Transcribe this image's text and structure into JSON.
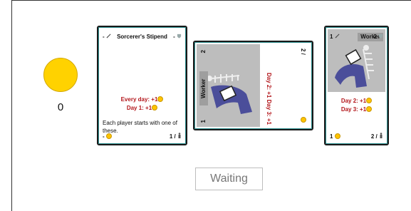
{
  "player": {
    "coins": "0"
  },
  "cards": [
    {
      "title": "Sorcerer's Stipend",
      "corner_tl": "-",
      "corner_tr": "-",
      "effect_line1": "Every day: +1",
      "effect_line2": "Day 1: +1",
      "description": "Each player starts with one of these.",
      "corner_bl": "-",
      "corner_br": "1 /"
    },
    {
      "title": "Worker",
      "corner_tl": "2",
      "corner_bl": "1",
      "corner_tr": "2 /",
      "effect_line1": "Day 2: +1",
      "effect_line2": "Day 3: +1",
      "rotated": true
    },
    {
      "title": "Worker",
      "corner_tl": "1",
      "corner_tr": "2",
      "effect_line1": "Day 2: +1",
      "effect_line2": "Day 3: +1",
      "corner_bl": "1",
      "corner_br": "2 /"
    }
  ],
  "status_text": "Waiting",
  "colors": {
    "coin": "#ffd200",
    "effect_text": "#b3161b",
    "card_border": "#1a1a1a",
    "art_bg": "#bdbdbd",
    "figure": "#4b4e9a"
  },
  "icons": [
    "coin-icon",
    "sword-icon",
    "shield-icon",
    "person-icon",
    "skeleton-art"
  ]
}
